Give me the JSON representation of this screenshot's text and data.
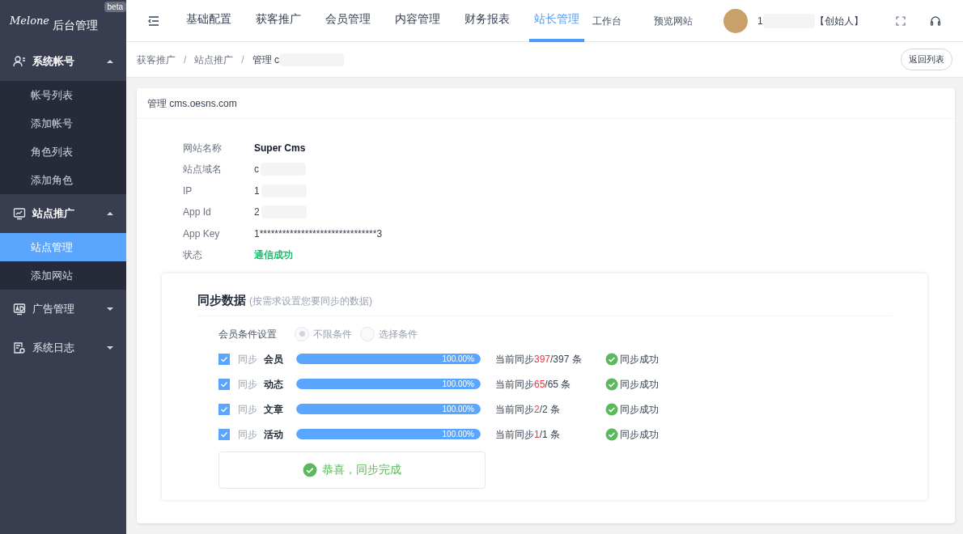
{
  "brand": {
    "logo": "Melone",
    "title": "后台管理",
    "badge": "beta"
  },
  "sidebar": {
    "groups": [
      {
        "label": "系统帐号",
        "expanded": true,
        "items": [
          {
            "label": "帐号列表",
            "selected": false
          },
          {
            "label": "添加帐号",
            "selected": false
          },
          {
            "label": "角色列表",
            "selected": false
          },
          {
            "label": "添加角色",
            "selected": false
          }
        ]
      },
      {
        "label": "站点推广",
        "expanded": true,
        "items": [
          {
            "label": "站点管理",
            "selected": true
          },
          {
            "label": "添加网站",
            "selected": false
          }
        ]
      },
      {
        "label": "广告管理",
        "expanded": false
      },
      {
        "label": "系统日志",
        "expanded": false
      }
    ]
  },
  "topnav": {
    "tabs": [
      {
        "label": "基础配置",
        "selected": false
      },
      {
        "label": "获客推广",
        "selected": false
      },
      {
        "label": "会员管理",
        "selected": false
      },
      {
        "label": "内容管理",
        "selected": false
      },
      {
        "label": "财务报表",
        "selected": false
      },
      {
        "label": "站长管理",
        "selected": true
      }
    ],
    "links": [
      "工作台",
      "预览网站"
    ],
    "user": {
      "name": "1",
      "role": "【创始人】"
    }
  },
  "breadcrumb": {
    "separator": "/",
    "items": [
      "获客推广",
      "站点推广",
      "管理 c"
    ]
  },
  "back_button": "返回列表",
  "card": {
    "title": "管理 cms.oesns.com",
    "fields": [
      {
        "label": "网站名称",
        "value": "Super Cms",
        "kind": "bold"
      },
      {
        "label": "站点域名",
        "value": "c",
        "kind": "redacted"
      },
      {
        "label": "IP",
        "value": "1",
        "kind": "redacted"
      },
      {
        "label": "App Id",
        "value": "2",
        "kind": "redacted"
      },
      {
        "label": "App Key",
        "value": "1*******************************3",
        "kind": "plain"
      },
      {
        "label": "状态",
        "value": "通信成功",
        "kind": "status"
      }
    ]
  },
  "sync": {
    "title": "同步数据",
    "hint": "(按需求设置您要同步的数据)",
    "condition": {
      "label": "会员条件设置",
      "options": [
        {
          "label": "不限条件",
          "selected": true,
          "disabled": true
        },
        {
          "label": "选择条件",
          "selected": false,
          "disabled": true
        }
      ]
    },
    "rows": [
      {
        "checked": true,
        "prefix": "同步",
        "name": "会员",
        "level": 1,
        "percent": "100.00%",
        "count_label": "当前同步",
        "synced": "397",
        "total": "/397 条",
        "status": "同步成功"
      },
      {
        "checked": true,
        "prefix": "同步",
        "name": "动态",
        "level": 1,
        "percent": "100.00%",
        "count_label": "当前同步",
        "synced": "65",
        "total": "/65 条",
        "status": "同步成功"
      },
      {
        "checked": true,
        "prefix": "同步",
        "name": "文章",
        "level": 1,
        "percent": "100.00%",
        "count_label": "当前同步",
        "synced": "2",
        "total": "/2 条",
        "status": "同步成功"
      },
      {
        "checked": true,
        "prefix": "同步",
        "name": "活动",
        "level": 1,
        "percent": "100.00%",
        "count_label": "当前同步",
        "synced": "1",
        "total": "/1 条",
        "status": "同步成功"
      }
    ],
    "result": "恭喜，同步完成"
  }
}
